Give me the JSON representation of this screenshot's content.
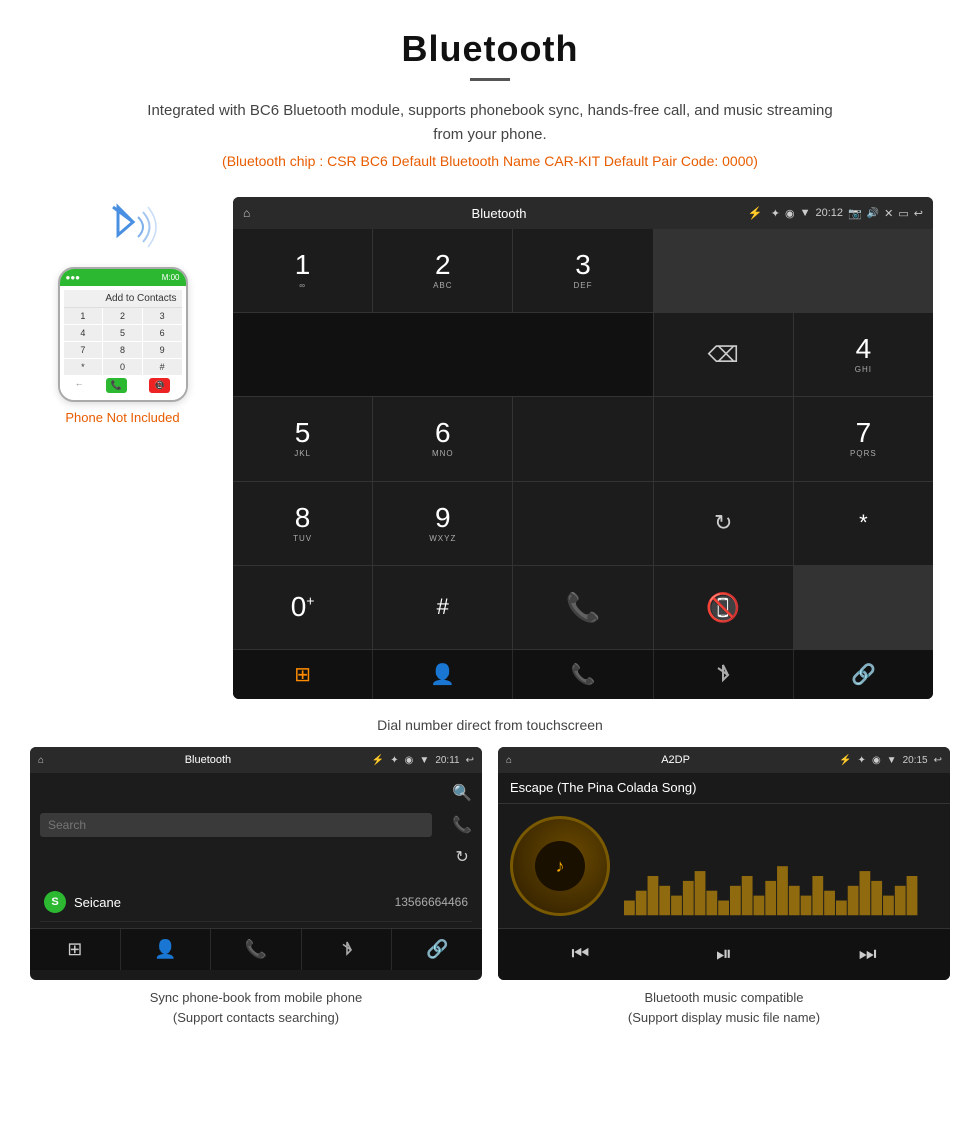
{
  "header": {
    "title": "Bluetooth",
    "description": "Integrated with BC6 Bluetooth module, supports phonebook sync, hands-free call, and music streaming from your phone.",
    "specs": "(Bluetooth chip : CSR BC6    Default Bluetooth Name CAR-KIT    Default Pair Code: 0000)"
  },
  "phone_mockup": {
    "not_included_label": "Phone Not Included",
    "add_contacts": "Add to Contacts",
    "keys": [
      "1",
      "2",
      "3",
      "4",
      "5",
      "6",
      "7",
      "8",
      "9",
      "*",
      "0",
      "#"
    ],
    "top_status": "M:00"
  },
  "dial_screen": {
    "status_bar": {
      "home_icon": "⌂",
      "title": "Bluetooth",
      "usb_icon": "⚡",
      "bluetooth_icon": "✦",
      "location_icon": "◉",
      "signal_icon": "▼",
      "time": "20:12",
      "camera_icon": "📷",
      "volume_icon": "🔊",
      "close_icon": "✕",
      "window_icon": "▭",
      "back_icon": "↩"
    },
    "keys": [
      {
        "num": "1",
        "sub": "∞"
      },
      {
        "num": "2",
        "sub": "ABC"
      },
      {
        "num": "3",
        "sub": "DEF"
      },
      {
        "num": "display",
        "sub": ""
      },
      {
        "num": "backspace",
        "sub": ""
      },
      {
        "num": "4",
        "sub": "GHI"
      },
      {
        "num": "5",
        "sub": "JKL"
      },
      {
        "num": "6",
        "sub": "MNO"
      },
      {
        "num": "",
        "sub": ""
      },
      {
        "num": "",
        "sub": ""
      },
      {
        "num": "7",
        "sub": "PQRS"
      },
      {
        "num": "8",
        "sub": "TUV"
      },
      {
        "num": "9",
        "sub": "WXYZ"
      },
      {
        "num": "",
        "sub": ""
      },
      {
        "num": "refresh",
        "sub": ""
      },
      {
        "num": "*",
        "sub": ""
      },
      {
        "num": "0+",
        "sub": ""
      },
      {
        "num": "#",
        "sub": ""
      },
      {
        "num": "call",
        "sub": ""
      },
      {
        "num": "endcall",
        "sub": ""
      }
    ],
    "nav": [
      "grid",
      "person",
      "phone",
      "bluetooth",
      "link"
    ],
    "caption": "Dial number direct from touchscreen"
  },
  "phonebook_screen": {
    "status_bar": {
      "home_icon": "⌂",
      "title": "Bluetooth",
      "usb_icon": "⚡",
      "time": "20:11",
      "back_icon": "↩"
    },
    "search_placeholder": "Search",
    "contacts": [
      {
        "initial": "S",
        "name": "Seicane",
        "number": "13566664466"
      }
    ],
    "nav": [
      "grid",
      "person",
      "phone",
      "bluetooth",
      "link"
    ],
    "caption_line1": "Sync phone-book from mobile phone",
    "caption_line2": "(Support contacts searching)"
  },
  "music_screen": {
    "status_bar": {
      "home_icon": "⌂",
      "title": "A2DP",
      "usb_icon": "⚡",
      "time": "20:15",
      "back_icon": "↩"
    },
    "song_title": "Escape (The Pina Colada Song)",
    "controls": [
      "prev",
      "play-pause",
      "next"
    ],
    "caption_line1": "Bluetooth music compatible",
    "caption_line2": "(Support display music file name)",
    "visualizer_bars": [
      15,
      25,
      40,
      30,
      20,
      35,
      45,
      25,
      15,
      30,
      40,
      20,
      35,
      50,
      30,
      20,
      40,
      25,
      15,
      30,
      45,
      35,
      20,
      30,
      40
    ]
  },
  "watermark": "Seicane"
}
